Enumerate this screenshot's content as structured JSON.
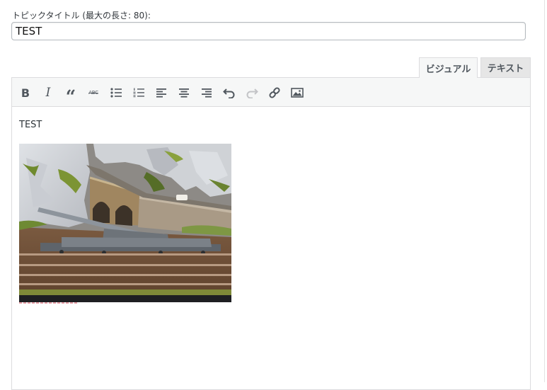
{
  "topic_title": {
    "label": "トピックタイトル (最大の長さ: 80):",
    "value": "TEST"
  },
  "editor_tabs": [
    {
      "label": "ビジュアル",
      "active": true
    },
    {
      "label": "テキスト",
      "active": false
    }
  ],
  "toolbar": {
    "buttons": [
      {
        "name": "bold",
        "glyph": "B"
      },
      {
        "name": "italic",
        "glyph": "I"
      },
      {
        "name": "blockquote",
        "glyph": "“"
      },
      {
        "name": "strikethrough",
        "glyph": "ABC"
      },
      {
        "name": "bulleted-list",
        "icon": "bullet-list-icon"
      },
      {
        "name": "numbered-list",
        "icon": "numbered-list-icon"
      },
      {
        "name": "align-left",
        "icon": "align-left-icon"
      },
      {
        "name": "align-center",
        "icon": "align-center-icon"
      },
      {
        "name": "align-right",
        "icon": "align-right-icon"
      },
      {
        "name": "undo",
        "icon": "undo-icon"
      },
      {
        "name": "redo",
        "icon": "redo-icon",
        "disabled": true
      },
      {
        "name": "insert-link",
        "icon": "link-icon"
      },
      {
        "name": "insert-image",
        "icon": "image-icon"
      }
    ]
  },
  "editor": {
    "body_text": "TEST",
    "image_description": "diorama photo with railway gun model"
  },
  "colors": {
    "border": "#dcdcde",
    "toolbar_bg": "#f6f7f7",
    "icon": "#50575e",
    "icon_disabled": "#c3c4c7"
  }
}
